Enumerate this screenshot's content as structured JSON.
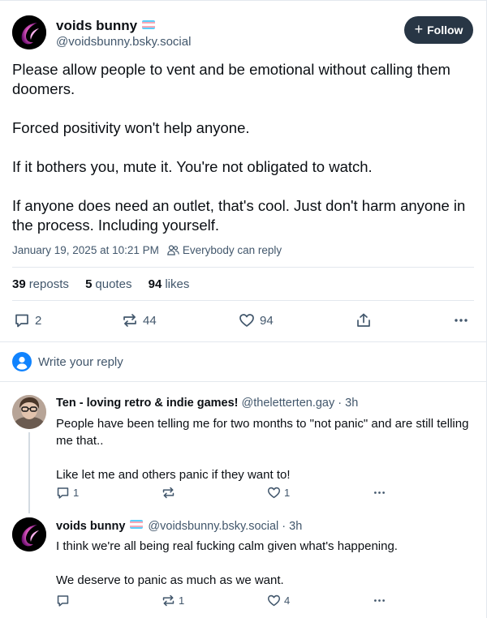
{
  "post": {
    "author_name": "voids bunny",
    "author_handle": "@voidsbunny.bsky.social",
    "follow_label": "Follow",
    "paragraphs": [
      "Please allow people to vent and be emotional without calling them doomers.",
      "Forced positivity won't help anyone.",
      "If it bothers you, mute it.  You're not obligated to watch.",
      "If anyone does need an outlet, that's cool.  Just don't harm anyone in the process.  Including yourself."
    ],
    "timestamp": "January 19, 2025 at 10:21 PM",
    "reply_setting": "Everybody can reply",
    "stats": {
      "reposts_count": "39",
      "reposts_label": "reposts",
      "quotes_count": "5",
      "quotes_label": "quotes",
      "likes_count": "94",
      "likes_label": "likes"
    },
    "actions": {
      "replies": "2",
      "reposts": "44",
      "likes": "94"
    }
  },
  "reply_prompt": "Write your reply",
  "replies": [
    {
      "author_name": "Ten - loving retro & indie games!",
      "author_handle": "@theletterten.gay",
      "age": "3h",
      "paragraphs": [
        "People have been telling me for two months to \"not panic\" and are still telling me that..",
        "Like let me and others panic if they want to!"
      ],
      "replies": "1",
      "reposts": "",
      "likes": "1"
    },
    {
      "author_name": "voids bunny",
      "author_handle": "@voidsbunny.bsky.social",
      "age": "3h",
      "paragraphs": [
        "I think we're all being real fucking calm given what's happening.",
        "We deserve to panic as much as we want."
      ],
      "replies": "",
      "reposts": "1",
      "likes": "4"
    }
  ],
  "colors": {
    "text": "#0b0f14",
    "muted": "#42576c",
    "border": "#e3e8ee",
    "follow_bg": "#283645",
    "link_blue": "#1083fe"
  }
}
